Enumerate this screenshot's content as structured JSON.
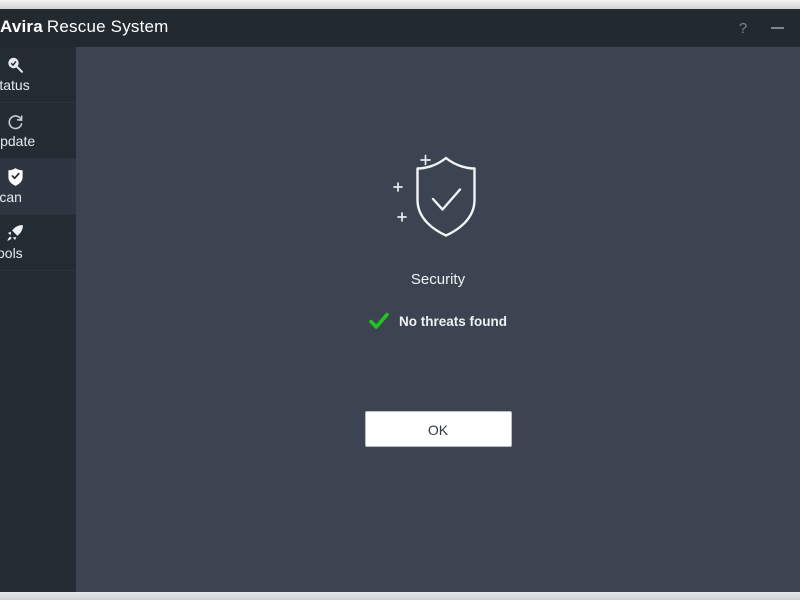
{
  "window": {
    "title_brand": "Avira",
    "title_rest": "Rescue System",
    "help_label": "?",
    "minimize_label": "",
    "help_icon": "question-mark-icon",
    "minimize_icon": "minimize-icon"
  },
  "sidebar": {
    "items": [
      {
        "label": "Status",
        "icon": "magnifier-status-icon",
        "active": false
      },
      {
        "label": "Update",
        "icon": "refresh-circle-icon",
        "active": false
      },
      {
        "label": "Scan",
        "icon": "shield-check-filled-icon",
        "active": true
      },
      {
        "label": "Tools",
        "icon": "rocket-icon",
        "active": false
      }
    ]
  },
  "main": {
    "hero_icon": "shield-check-sparkle-icon",
    "hero_label": "Security",
    "status_icon": "green-check-icon",
    "status_text": "No threats found",
    "ok_label": "OK"
  },
  "colors": {
    "titlebar": "#222a30",
    "sidebar": "#242c33",
    "sidebar_active": "#2e3741",
    "content": "#3b4450",
    "accent_green": "#22c422",
    "text_primary": "#eef1f3",
    "button_bg": "#ffffff"
  }
}
